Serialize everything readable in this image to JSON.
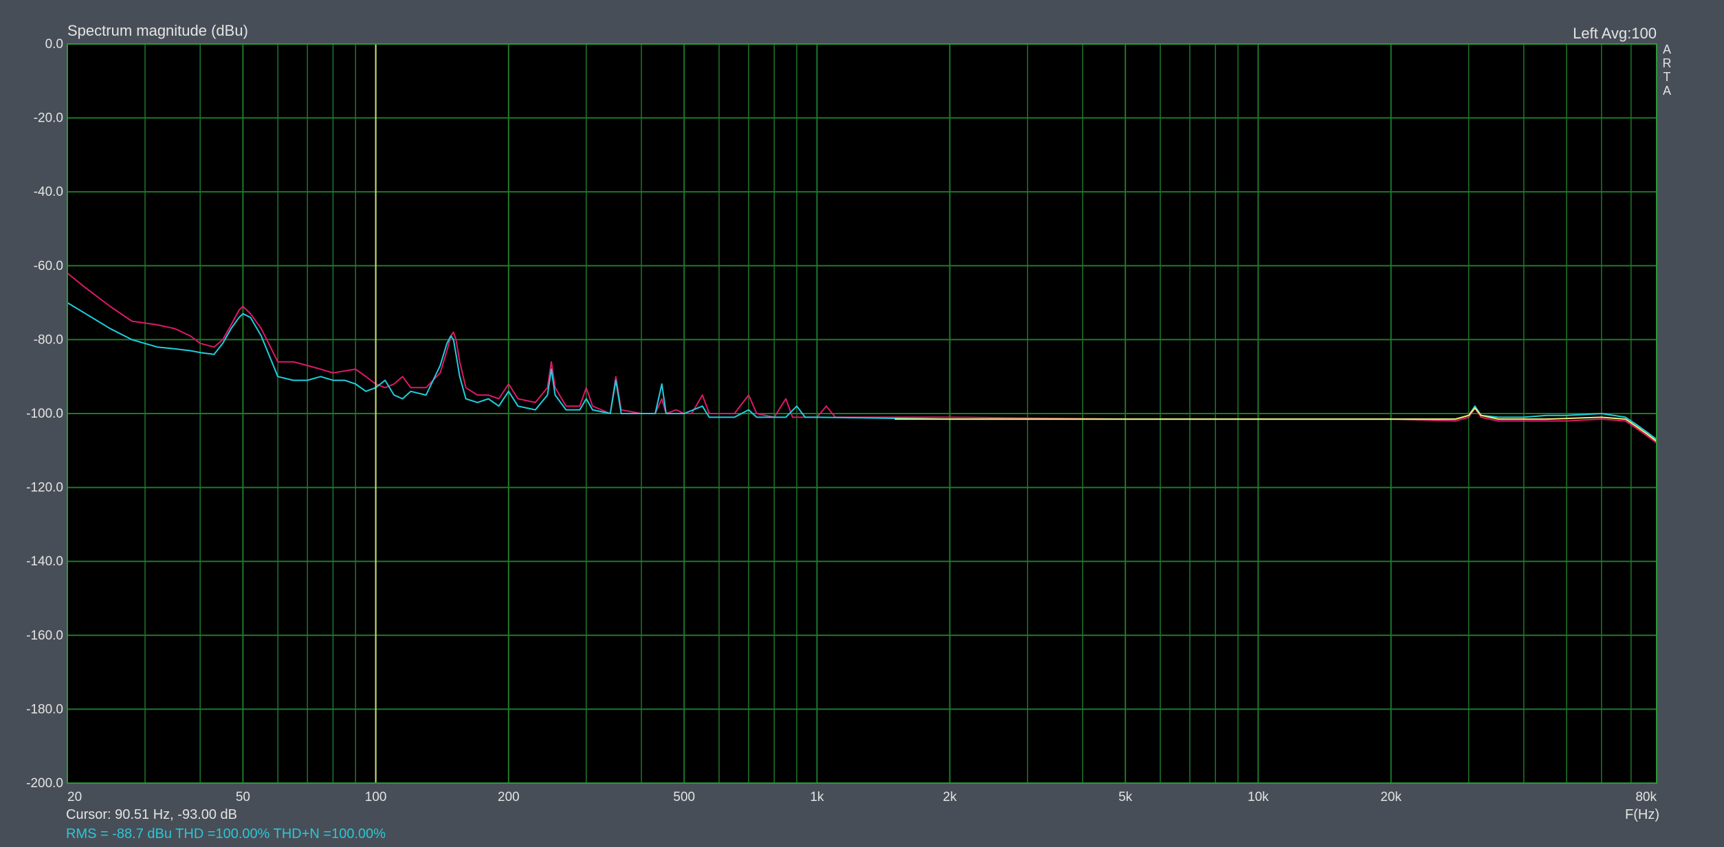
{
  "window": {
    "title": "Spectrum magnitude (dBu)",
    "channel_info": "Left  Avg:100",
    "logo_letters": [
      "A",
      "R",
      "T",
      "A"
    ],
    "unit_label": "F(Hz)",
    "cursor_readout": "Cursor: 90.51 Hz, -93.00 dB",
    "stats_readout": "RMS =  -88.7 dBu  THD =100.00%  THD+N =100.00%"
  },
  "colors": {
    "background": "#484e57",
    "plot_background": "#000000",
    "grid": "#1e7a2a",
    "text": "#e4e4e4",
    "marker": "#d8d870",
    "stats_text": "#28c8d8",
    "series_magenta": "#e0186a",
    "series_cyan": "#20d0e0",
    "series_yellow": "#f0f070"
  },
  "chart_data": {
    "type": "line",
    "title": "Spectrum magnitude (dBu)",
    "xlabel": "F(Hz)",
    "ylabel": "",
    "x_scale": "log",
    "xlim": [
      20,
      80000
    ],
    "ylim": [
      -200,
      0
    ],
    "grid": true,
    "x_tick_labels": [
      {
        "value": 20,
        "label": "20"
      },
      {
        "value": 50,
        "label": "50"
      },
      {
        "value": 100,
        "label": "100"
      },
      {
        "value": 200,
        "label": "200"
      },
      {
        "value": 500,
        "label": "500"
      },
      {
        "value": 1000,
        "label": "1k"
      },
      {
        "value": 2000,
        "label": "2k"
      },
      {
        "value": 5000,
        "label": "5k"
      },
      {
        "value": 10000,
        "label": "10k"
      },
      {
        "value": 20000,
        "label": "20k"
      },
      {
        "value": 80000,
        "label": "80k"
      }
    ],
    "x_minor_grid": [
      30,
      40,
      60,
      70,
      80,
      90,
      300,
      400,
      600,
      700,
      800,
      900,
      3000,
      4000,
      6000,
      7000,
      8000,
      9000,
      30000,
      40000,
      50000,
      60000,
      70000
    ],
    "y_tick_labels": [
      {
        "value": 0,
        "label": "0.0"
      },
      {
        "value": -20,
        "label": "-20.0"
      },
      {
        "value": -40,
        "label": "-40.0"
      },
      {
        "value": -60,
        "label": "-60.0"
      },
      {
        "value": -80,
        "label": "-80.0"
      },
      {
        "value": -100,
        "label": "-100.0"
      },
      {
        "value": -120,
        "label": "-120.0"
      },
      {
        "value": -140,
        "label": "-140.0"
      },
      {
        "value": -160,
        "label": "-160.0"
      },
      {
        "value": -180,
        "label": "-180.0"
      },
      {
        "value": -200,
        "label": "-200.0"
      }
    ],
    "cursor": {
      "x": 90.51,
      "y": -93.0
    },
    "series": [
      {
        "color": "#e0186a",
        "points": [
          [
            20,
            -62
          ],
          [
            22,
            -66
          ],
          [
            25,
            -71
          ],
          [
            28,
            -75
          ],
          [
            32,
            -76
          ],
          [
            35,
            -77
          ],
          [
            38,
            -79
          ],
          [
            40,
            -81
          ],
          [
            43,
            -82
          ],
          [
            45,
            -80
          ],
          [
            47,
            -76
          ],
          [
            49,
            -72
          ],
          [
            50,
            -71
          ],
          [
            52,
            -73
          ],
          [
            55,
            -77
          ],
          [
            60,
            -86
          ],
          [
            65,
            -86
          ],
          [
            70,
            -87
          ],
          [
            75,
            -88
          ],
          [
            80,
            -89
          ],
          [
            90,
            -88
          ],
          [
            95,
            -90
          ],
          [
            100,
            -92
          ],
          [
            105,
            -93
          ],
          [
            110,
            -92
          ],
          [
            115,
            -90
          ],
          [
            120,
            -93
          ],
          [
            130,
            -93
          ],
          [
            140,
            -89
          ],
          [
            145,
            -83
          ],
          [
            148,
            -79
          ],
          [
            150,
            -78
          ],
          [
            152,
            -80
          ],
          [
            155,
            -86
          ],
          [
            160,
            -93
          ],
          [
            170,
            -95
          ],
          [
            180,
            -95
          ],
          [
            190,
            -96
          ],
          [
            200,
            -92
          ],
          [
            210,
            -96
          ],
          [
            230,
            -97
          ],
          [
            245,
            -93
          ],
          [
            250,
            -86
          ],
          [
            255,
            -93
          ],
          [
            270,
            -98
          ],
          [
            290,
            -98
          ],
          [
            300,
            -93
          ],
          [
            310,
            -98
          ],
          [
            340,
            -100
          ],
          [
            350,
            -90
          ],
          [
            360,
            -99
          ],
          [
            400,
            -100
          ],
          [
            430,
            -100
          ],
          [
            445,
            -96
          ],
          [
            455,
            -100
          ],
          [
            480,
            -99
          ],
          [
            500,
            -100
          ],
          [
            520,
            -100
          ],
          [
            550,
            -95
          ],
          [
            570,
            -100
          ],
          [
            650,
            -100
          ],
          [
            700,
            -95
          ],
          [
            730,
            -100
          ],
          [
            800,
            -101
          ],
          [
            850,
            -96
          ],
          [
            880,
            -101
          ],
          [
            1000,
            -101
          ],
          [
            1050,
            -98
          ],
          [
            1100,
            -101
          ],
          [
            2000,
            -101
          ],
          [
            5000,
            -101.5
          ],
          [
            10000,
            -101.5
          ],
          [
            20000,
            -101.5
          ],
          [
            28000,
            -102
          ],
          [
            30000,
            -101
          ],
          [
            31000,
            -98.5
          ],
          [
            32000,
            -101
          ],
          [
            35000,
            -102
          ],
          [
            40000,
            -102
          ],
          [
            45000,
            -102
          ],
          [
            50000,
            -102
          ],
          [
            60000,
            -101.5
          ],
          [
            68000,
            -102
          ],
          [
            72000,
            -104
          ],
          [
            76000,
            -106
          ],
          [
            80000,
            -108
          ]
        ]
      },
      {
        "color": "#20d0e0",
        "points": [
          [
            20,
            -70
          ],
          [
            22,
            -73
          ],
          [
            25,
            -77
          ],
          [
            28,
            -80
          ],
          [
            32,
            -82
          ],
          [
            35,
            -82.5
          ],
          [
            38,
            -83
          ],
          [
            40,
            -83.5
          ],
          [
            43,
            -84
          ],
          [
            45,
            -81
          ],
          [
            47,
            -77
          ],
          [
            49,
            -74
          ],
          [
            50,
            -73
          ],
          [
            52,
            -74
          ],
          [
            55,
            -79
          ],
          [
            60,
            -90
          ],
          [
            65,
            -91
          ],
          [
            70,
            -91
          ],
          [
            75,
            -90
          ],
          [
            80,
            -91
          ],
          [
            85,
            -91
          ],
          [
            90,
            -92
          ],
          [
            95,
            -94
          ],
          [
            100,
            -93
          ],
          [
            105,
            -91
          ],
          [
            110,
            -95
          ],
          [
            115,
            -96
          ],
          [
            120,
            -94
          ],
          [
            130,
            -95
          ],
          [
            140,
            -87
          ],
          [
            145,
            -81
          ],
          [
            148,
            -79
          ],
          [
            150,
            -80
          ],
          [
            152,
            -84
          ],
          [
            155,
            -90
          ],
          [
            160,
            -96
          ],
          [
            170,
            -97
          ],
          [
            180,
            -96
          ],
          [
            190,
            -98
          ],
          [
            200,
            -94
          ],
          [
            210,
            -98
          ],
          [
            230,
            -99
          ],
          [
            245,
            -95
          ],
          [
            250,
            -88
          ],
          [
            255,
            -95
          ],
          [
            270,
            -99
          ],
          [
            290,
            -99
          ],
          [
            300,
            -96
          ],
          [
            310,
            -99
          ],
          [
            340,
            -100
          ],
          [
            350,
            -91
          ],
          [
            360,
            -100
          ],
          [
            400,
            -100
          ],
          [
            430,
            -100
          ],
          [
            445,
            -92
          ],
          [
            455,
            -100
          ],
          [
            480,
            -100
          ],
          [
            500,
            -100
          ],
          [
            550,
            -98
          ],
          [
            570,
            -101
          ],
          [
            650,
            -101
          ],
          [
            700,
            -99
          ],
          [
            730,
            -101
          ],
          [
            850,
            -101
          ],
          [
            900,
            -98
          ],
          [
            940,
            -101
          ],
          [
            1000,
            -101
          ],
          [
            2000,
            -101.5
          ],
          [
            5000,
            -101.5
          ],
          [
            10000,
            -101.5
          ],
          [
            20000,
            -101.5
          ],
          [
            28000,
            -101.5
          ],
          [
            30000,
            -100.5
          ],
          [
            31000,
            -98
          ],
          [
            32000,
            -100.5
          ],
          [
            35000,
            -101
          ],
          [
            40000,
            -101
          ],
          [
            45000,
            -100.5
          ],
          [
            50000,
            -100.5
          ],
          [
            60000,
            -100
          ],
          [
            68000,
            -101
          ],
          [
            72000,
            -103
          ],
          [
            76000,
            -105
          ],
          [
            80000,
            -107
          ]
        ]
      },
      {
        "color": "#f0f070",
        "points": [
          [
            1500,
            -101.5
          ],
          [
            3000,
            -101.5
          ],
          [
            5000,
            -101.5
          ],
          [
            10000,
            -101.5
          ],
          [
            20000,
            -101.5
          ],
          [
            28000,
            -101.5
          ],
          [
            30000,
            -100.5
          ],
          [
            31000,
            -98.5
          ],
          [
            32000,
            -100.5
          ],
          [
            35000,
            -101.5
          ],
          [
            45000,
            -101.5
          ],
          [
            60000,
            -101
          ],
          [
            68000,
            -101.5
          ],
          [
            72000,
            -103.5
          ],
          [
            76000,
            -105.5
          ],
          [
            80000,
            -107.5
          ]
        ]
      }
    ]
  }
}
